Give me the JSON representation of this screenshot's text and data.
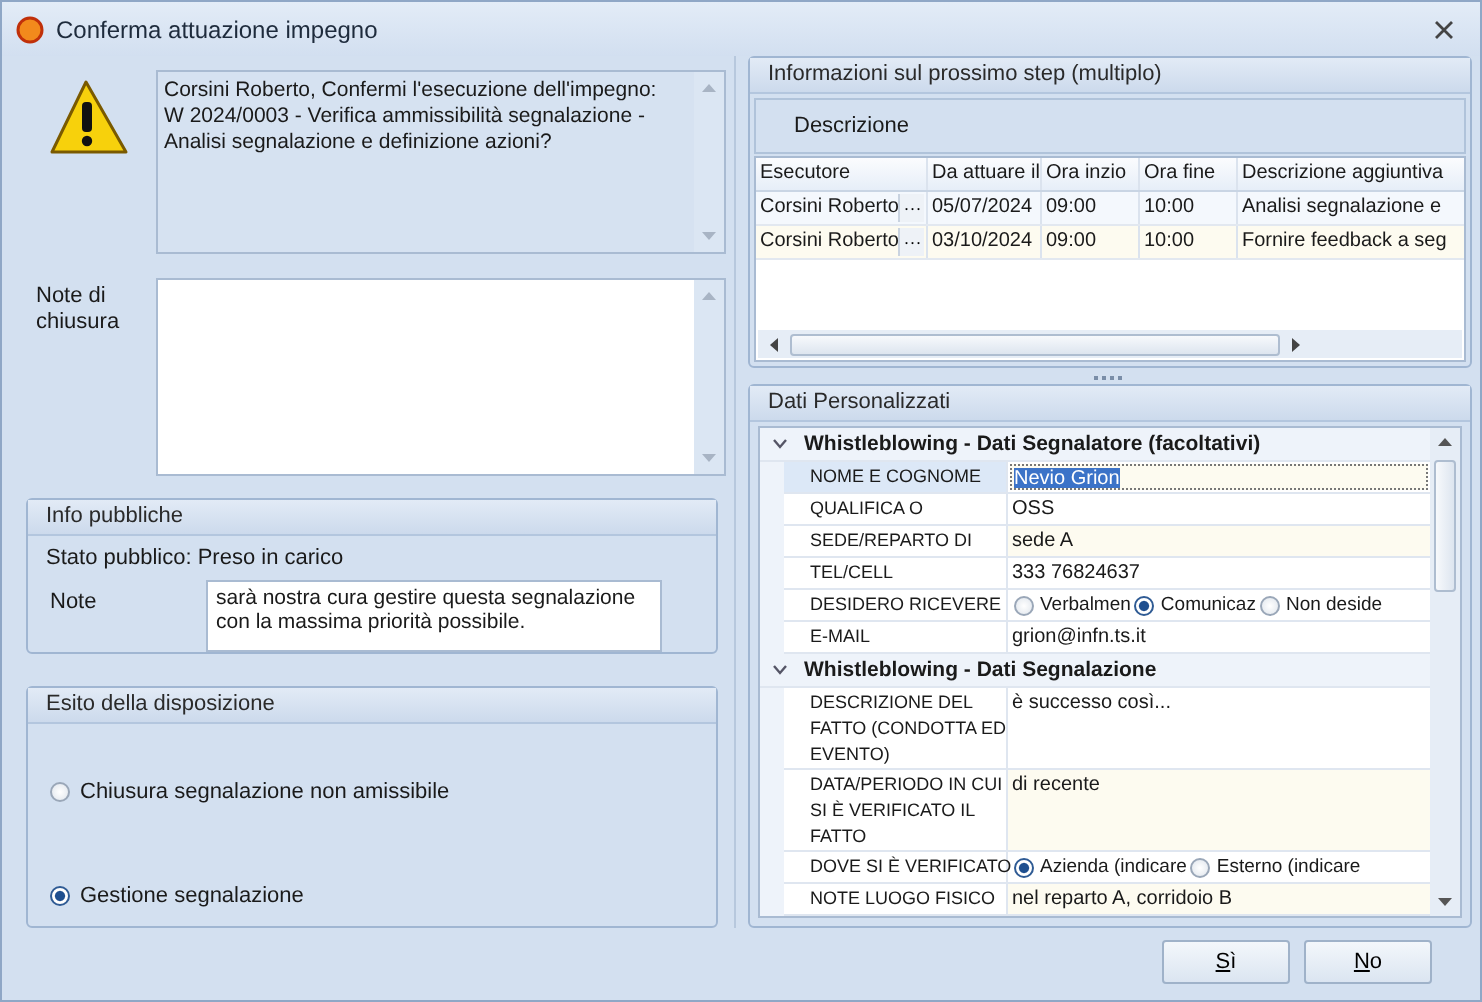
{
  "window": {
    "title": "Conferma attuazione impegno"
  },
  "message": {
    "lines": [
      "Corsini Roberto, Confermi l'esecuzione dell'impegno:",
      "W 2024/0003 - Verifica ammissibilità segnalazione - Analisi segnalazione e definizione azioni?"
    ]
  },
  "closing_note": {
    "label": "Note di chiusura"
  },
  "public_info": {
    "title": "Info pubbliche",
    "status": "Stato pubblico: Preso in carico",
    "note_label": "Note",
    "note_value": "sarà nostra cura gestire questa segnalazione con la massima priorità possibile."
  },
  "outcome": {
    "title": "Esito della disposizione",
    "options": [
      {
        "label": "Chiusura segnalazione non amissibile",
        "selected": false
      },
      {
        "label": "Gestione segnalazione",
        "selected": true
      }
    ]
  },
  "next_step": {
    "title": "Informazioni sul prossimo step (multiplo)",
    "description_label": "Descrizione",
    "columns": [
      "Esecutore",
      "Da attuare il",
      "Ora inzio",
      "Ora fine",
      "Descrizione aggiuntiva"
    ],
    "ellipsis": "···",
    "rows": [
      {
        "cells": [
          "Corsini Roberto",
          "05/07/2024",
          "09:00",
          "10:00",
          "Analisi segnalazione e"
        ]
      },
      {
        "cells": [
          "Corsini Roberto",
          "03/10/2024",
          "09:00",
          "10:00",
          "Fornire feedback a seg"
        ]
      }
    ]
  },
  "custom_data": {
    "title": "Dati Personalizzati",
    "sections": [
      {
        "title": "Whistleblowing - Dati Segnalatore (facoltativi)",
        "expanded": true,
        "fields": [
          {
            "kind": "text",
            "label": "NOME E COGNOME",
            "value": "Nevio Grion",
            "required": true,
            "selected": true
          },
          {
            "kind": "text",
            "label": "QUALIFICA O",
            "value": "OSS",
            "required": false,
            "selected": false
          },
          {
            "kind": "text",
            "label": "SEDE/REPARTO DI",
            "value": "sede A",
            "required": true,
            "selected": false
          },
          {
            "kind": "text",
            "label": "TEL/CELL",
            "value": "333 76824637",
            "required": false,
            "selected": false
          },
          {
            "kind": "radio",
            "label": "DESIDERO RICEVERE",
            "options": [
              {
                "label": "Verbalmen",
                "selected": false
              },
              {
                "label": "Comunicaz",
                "selected": true
              },
              {
                "label": "Non deside",
                "selected": false
              }
            ]
          },
          {
            "kind": "text",
            "label": "E-MAIL",
            "value": "grion@infn.ts.it",
            "required": false,
            "selected": false
          }
        ]
      },
      {
        "title": "Whistleblowing - Dati Segnalazione",
        "expanded": true,
        "fields": [
          {
            "kind": "memo",
            "label": "DESCRIZIONE DEL FATTO (CONDOTTA ED EVENTO)",
            "value": "è successo così...",
            "required": false,
            "selected": false
          },
          {
            "kind": "memo",
            "label": "DATA/PERIODO IN CUI SI È VERIFICATO IL FATTO",
            "value": "di recente",
            "required": true,
            "selected": false
          },
          {
            "kind": "radio",
            "label": "DOVE SI È VERIFICATO",
            "options": [
              {
                "label": "Azienda (indicare",
                "selected": true
              },
              {
                "label": "Esterno (indicare",
                "selected": false
              }
            ]
          },
          {
            "kind": "text",
            "label": "NOTE LUOGO FISICO",
            "value": "nel reparto A, corridoio B",
            "required": true,
            "selected": false
          }
        ]
      }
    ]
  },
  "buttons": [
    {
      "label": "Sì"
    },
    {
      "label": "No"
    }
  ]
}
